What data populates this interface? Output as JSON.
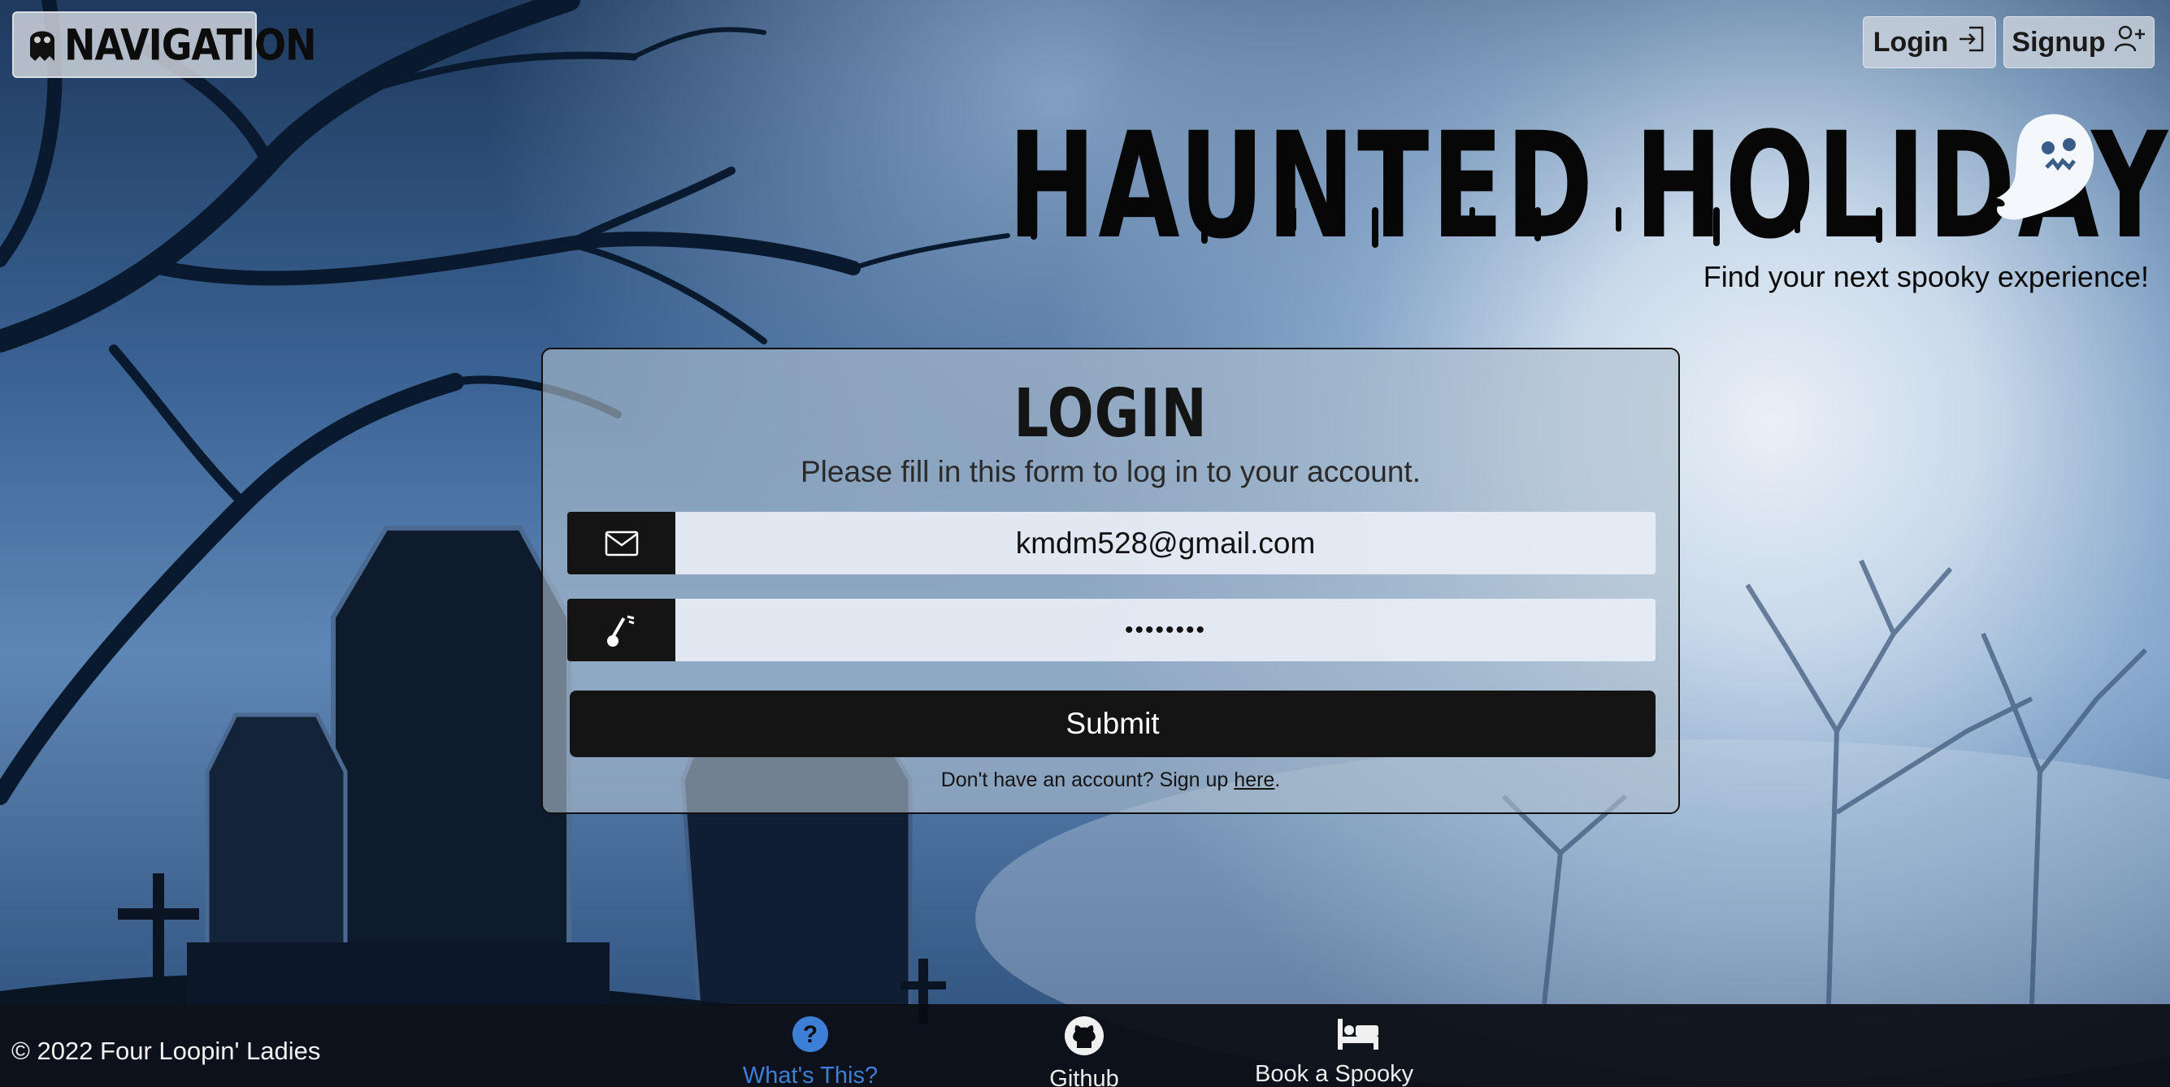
{
  "nav": {
    "label": "NAVIGATION",
    "icon": "ghost-icon"
  },
  "auth": {
    "login_label": "Login",
    "signup_label": "Signup",
    "login_icon": "login-icon",
    "signup_icon": "add-user-icon"
  },
  "hero": {
    "title": "HAUNTED HOLIDAYS",
    "tagline": "Find your next spooky experience!",
    "mascot_icon": "ghost-icon"
  },
  "login": {
    "title": "LOGIN",
    "subtitle": "Please fill in this form to log in to your account.",
    "email_value": "kmdm528@gmail.com",
    "email_icon": "envelope-icon",
    "password_value": "••••••••",
    "password_icon": "key-icon",
    "submit_label": "Submit",
    "signup_prompt": "Don't have an account? Sign up ",
    "signup_link": "here",
    "signup_suffix": "."
  },
  "footer": {
    "copyright": "© 2022 Four Loopin' Ladies",
    "links": [
      {
        "label": "What's This?",
        "icon": "question-circle-icon",
        "color": "#3d7fd6"
      },
      {
        "label": "Github",
        "icon": "github-icon"
      },
      {
        "label": "Book a Spooky Stay",
        "icon": "bed-icon"
      }
    ]
  }
}
